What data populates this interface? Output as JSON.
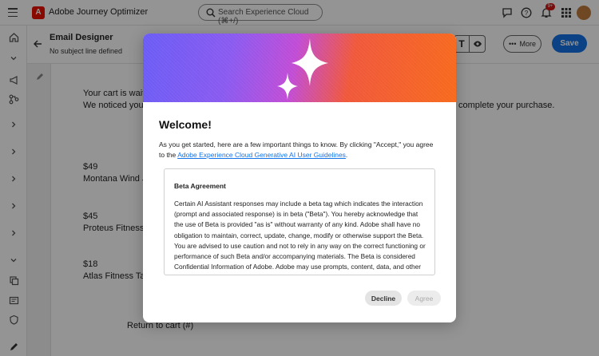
{
  "topbar": {
    "app_name": "Adobe Journey Optimizer",
    "logo_letter": "A",
    "search_placeholder": "Search Experience Cloud (⌘+/)",
    "notification_count": "9+"
  },
  "editor": {
    "title": "Email Designer",
    "subtitle": "No subject line defined",
    "more_label": "More",
    "save_label": "Save",
    "text_mode_glyph": "T"
  },
  "email": {
    "line1": "Your cart is waitin",
    "line2": "We noticed you le",
    "line2_tail": "complete your purchase.",
    "products": [
      {
        "price": "$49",
        "name": "Montana Wind Ja"
      },
      {
        "price": "$45",
        "name": "Proteus Fitness J"
      },
      {
        "price": "$18",
        "name": "Atlas Fitness Tan"
      }
    ],
    "return_link": "Return to cart (#)"
  },
  "modal": {
    "title": "Welcome!",
    "intro_text": "As you get started, here are a few important things to know. By clicking \"Accept,\" you agree to the",
    "guidelines_link": "Adobe Experience Cloud Generative AI User Guidelines",
    "intro_end": ".",
    "agreement_title": "Beta Agreement",
    "agreement_body": "Certain AI Assistant responses may include a beta tag which indicates the interaction (prompt and associated response) is in beta (\"Beta\"). You hereby acknowledge that the use of Beta is provided \"as is\" without warranty of any kind. Adobe shall have no obligation to maintain, correct, update, change, modify or otherwise support the Beta. You are advised to use caution and not to rely in any way on the correct functioning or performance of such Beta and/or accompanying materials. The Beta is considered Confidential Information of Adobe. Adobe may use prompts, content, data, and other materials that are input or imported into the Beta and responses provided to You for",
    "decline_label": "Decline",
    "agree_label": "Agree"
  },
  "colors": {
    "accent": "#1473e6",
    "brand": "#eb1000"
  }
}
